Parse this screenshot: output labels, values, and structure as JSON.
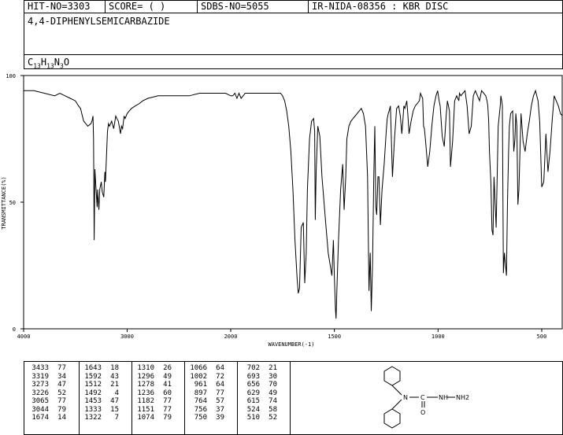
{
  "header": {
    "hit_no": "HIT-NO=3303",
    "score": "SCORE=  (   )",
    "sdbs_no": "SDBS-NO=5055",
    "method": "IR-NIDA-08356 : KBR DISC"
  },
  "compound": {
    "name": "4,4-DIPHENYLSEMICARBAZIDE",
    "formula_parts": [
      "C",
      "13",
      "H",
      "13",
      "N",
      "3",
      "O"
    ]
  },
  "chart_data": {
    "type": "line",
    "title": "",
    "xlabel": "WAVENUMBER(-1)",
    "ylabel": "TRANSMITTANCE(%)",
    "xlim": [
      4000,
      400
    ],
    "ylim": [
      0,
      100
    ],
    "x_ticks": [
      "4000",
      "3000",
      "2000",
      "1500",
      "1000",
      "500"
    ],
    "y_ticks": [
      "100",
      "50",
      "0"
    ],
    "x_tick_values": [
      4000,
      3000,
      2000,
      1500,
      1000,
      500
    ],
    "y_tick_values": [
      100,
      50,
      0
    ],
    "grid": false,
    "series": [
      {
        "x": [
          4000,
          3900,
          3800,
          3700,
          3650,
          3600,
          3550,
          3500,
          3470,
          3450,
          3433,
          3420,
          3400,
          3380,
          3350,
          3340,
          3330,
          3325,
          3319,
          3312,
          3300,
          3290,
          3285,
          3273,
          3265,
          3250,
          3240,
          3226,
          3215,
          3210,
          3190,
          3180,
          3170,
          3150,
          3130,
          3110,
          3100,
          3085,
          3065,
          3055,
          3044,
          3030,
          3020,
          3000,
          2960,
          2920,
          2880,
          2850,
          2800,
          2700,
          2600,
          2500,
          2400,
          2300,
          2200,
          2100,
          2050,
          2000,
          1990,
          1980,
          1970,
          1960,
          1950,
          1940,
          1930,
          1900,
          1850,
          1800,
          1780,
          1770,
          1760,
          1750,
          1740,
          1730,
          1720,
          1710,
          1700,
          1690,
          1680,
          1674,
          1668,
          1660,
          1650,
          1643,
          1636,
          1630,
          1620,
          1610,
          1600,
          1595,
          1592,
          1588,
          1580,
          1570,
          1560,
          1550,
          1540,
          1530,
          1520,
          1512,
          1505,
          1500,
          1495,
          1492,
          1488,
          1480,
          1470,
          1460,
          1453,
          1445,
          1440,
          1430,
          1420,
          1410,
          1400,
          1390,
          1380,
          1370,
          1360,
          1350,
          1340,
          1333,
          1327,
          1322,
          1316,
          1310,
          1305,
          1300,
          1296,
          1290,
          1285,
          1278,
          1270,
          1260,
          1250,
          1245,
          1240,
          1236,
          1230,
          1220,
          1210,
          1200,
          1190,
          1182,
          1175,
          1170,
          1165,
          1160,
          1151,
          1145,
          1140,
          1130,
          1120,
          1110,
          1100,
          1090,
          1085,
          1080,
          1074,
          1070,
          1066,
          1060,
          1050,
          1040,
          1030,
          1020,
          1010,
          1002,
          995,
          990,
          980,
          970,
          961,
          955,
          945,
          940,
          930,
          920,
          910,
          900,
          897,
          890,
          880,
          870,
          860,
          850,
          840,
          830,
          820,
          810,
          800,
          790,
          780,
          770,
          764,
          760,
          756,
          752,
          745,
          740,
          735,
          730,
          720,
          710,
          700,
          697,
          693,
          690,
          685,
          680,
          670,
          665,
          660,
          656,
          650,
          640,
          635,
          629,
          625,
          620,
          615,
          610,
          600,
          590,
          580,
          570,
          560,
          550,
          540,
          530,
          524,
          518,
          510,
          500,
          490,
          480,
          470,
          460,
          450,
          440,
          430,
          420,
          410,
          400
        ],
        "y": [
          94,
          94,
          93,
          92,
          93,
          92,
          91,
          90,
          88,
          87,
          84,
          82,
          81,
          80,
          81,
          82,
          84,
          75,
          35,
          63,
          55,
          48,
          55,
          47,
          55,
          58,
          54,
          52,
          62,
          58,
          78,
          81,
          80,
          82,
          79,
          84,
          83,
          82,
          77,
          80,
          79,
          84,
          83,
          85,
          87,
          88,
          89,
          90,
          91,
          92,
          92,
          92,
          92,
          93,
          93,
          93,
          93,
          92,
          92,
          93,
          91,
          93,
          91,
          92,
          93,
          93,
          93,
          93,
          93,
          93,
          93,
          92,
          90,
          86,
          80,
          70,
          55,
          35,
          20,
          14,
          16,
          40,
          42,
          18,
          30,
          55,
          75,
          82,
          83,
          78,
          43,
          62,
          80,
          76,
          60,
          50,
          40,
          30,
          25,
          21,
          35,
          20,
          8,
          4,
          15,
          35,
          55,
          65,
          47,
          60,
          75,
          80,
          82,
          83,
          84,
          85,
          86,
          87,
          85,
          80,
          60,
          15,
          30,
          7,
          25,
          60,
          80,
          48,
          45,
          60,
          60,
          41,
          55,
          65,
          78,
          83,
          85,
          86,
          88,
          60,
          75,
          87,
          88,
          84,
          77,
          82,
          88,
          87,
          90,
          84,
          77,
          82,
          86,
          88,
          89,
          90,
          93,
          92,
          91,
          80,
          79,
          74,
          64,
          70,
          80,
          88,
          92,
          94,
          90,
          88,
          76,
          72,
          84,
          90,
          86,
          64,
          74,
          90,
          92,
          90,
          93,
          92,
          93,
          94,
          88,
          77,
          80,
          92,
          94,
          92,
          90,
          94,
          93,
          92,
          90,
          88,
          82,
          70,
          57,
          39,
          37,
          60,
          40,
          80,
          88,
          92,
          90,
          88,
          22,
          30,
          21,
          50,
          70,
          80,
          85,
          86,
          70,
          75,
          85,
          80,
          49,
          55,
          85,
          74,
          70,
          77,
          82,
          88,
          92,
          94,
          92,
          90,
          82,
          56,
          58,
          77,
          62,
          70,
          82,
          92,
          90,
          88,
          85,
          84
        ]
      }
    ]
  },
  "peak_table": [
    [
      [
        "3433",
        "77"
      ],
      [
        "3319",
        "34"
      ],
      [
        "3273",
        "47"
      ],
      [
        "3226",
        "52"
      ],
      [
        "3065",
        "77"
      ],
      [
        "3044",
        "79"
      ],
      [
        "1674",
        "14"
      ]
    ],
    [
      [
        "1643",
        "18"
      ],
      [
        "1592",
        "43"
      ],
      [
        "1512",
        "21"
      ],
      [
        "1492",
        "4"
      ],
      [
        "1453",
        "47"
      ],
      [
        "1333",
        "15"
      ],
      [
        "1322",
        "7"
      ]
    ],
    [
      [
        "1310",
        "26"
      ],
      [
        "1296",
        "49"
      ],
      [
        "1278",
        "41"
      ],
      [
        "1236",
        "60"
      ],
      [
        "1182",
        "77"
      ],
      [
        "1151",
        "77"
      ],
      [
        "1074",
        "79"
      ]
    ],
    [
      [
        "1066",
        "64"
      ],
      [
        "1002",
        "72"
      ],
      [
        "961",
        "64"
      ],
      [
        "897",
        "77"
      ],
      [
        "764",
        "57"
      ],
      [
        "756",
        "37"
      ],
      [
        "750",
        "39"
      ]
    ],
    [
      [
        "702",
        "21"
      ],
      [
        "693",
        "30"
      ],
      [
        "656",
        "70"
      ],
      [
        "629",
        "49"
      ],
      [
        "615",
        "74"
      ],
      [
        "524",
        "58"
      ],
      [
        "510",
        "52"
      ]
    ]
  ],
  "structure": {
    "label_n": "N",
    "label_c": "C",
    "label_o": "O",
    "label_h": "H",
    "label_nh2": "NH2"
  }
}
